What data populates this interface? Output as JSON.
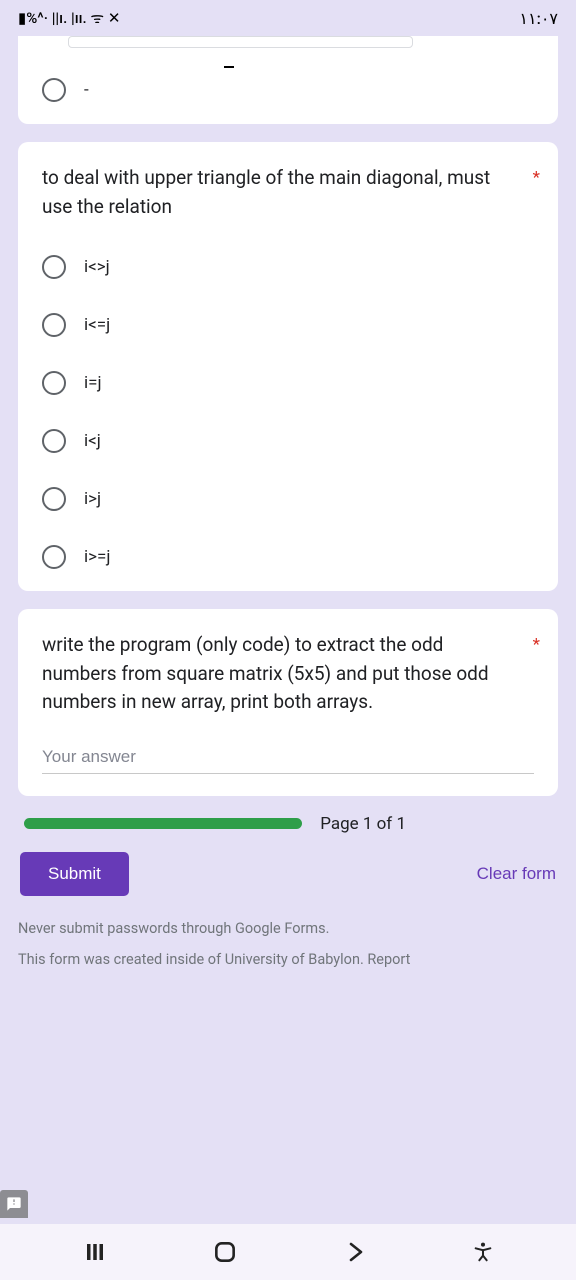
{
  "status": {
    "left": "▮%^· ||ı. |ıı. ᯤ ✕",
    "right": "١١:٠٧"
  },
  "q0": {
    "dash": "-"
  },
  "q1": {
    "title": "to deal with upper triangle of the main diagonal, must use the relation",
    "options": [
      "i<>j",
      "i<=j",
      "i=j",
      "i<j",
      "i>j",
      "i>=j"
    ]
  },
  "q2": {
    "title": "write the program (only code) to extract the odd numbers from square matrix (5x5) and put those odd numbers in new array, print both arrays.",
    "placeholder": "Your answer"
  },
  "page_of": "Page 1 of 1",
  "submit": "Submit",
  "clear": "Clear form",
  "warn": "Never submit passwords through Google Forms.",
  "created": "This form was created inside of University of Babylon. Report"
}
